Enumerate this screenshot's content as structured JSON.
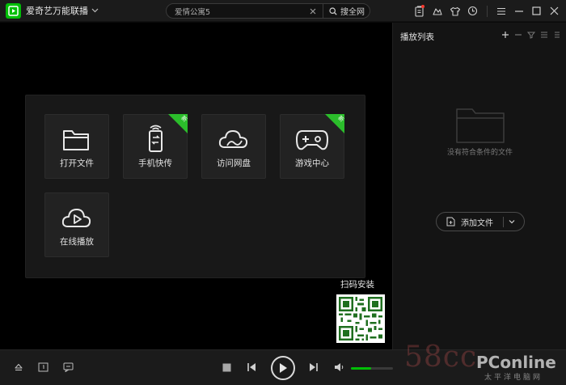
{
  "titlebar": {
    "app_title": "爱奇艺万能联播",
    "search_value": "爱情公寓5",
    "search_button_label": "搜全网"
  },
  "tiles": [
    {
      "label": "打开文件",
      "icon": "folder-icon",
      "badge": ""
    },
    {
      "label": "手机快传",
      "icon": "phone-transfer-icon",
      "badge": "新"
    },
    {
      "label": "访问网盘",
      "icon": "cloud-icon",
      "badge": ""
    },
    {
      "label": "游戏中心",
      "icon": "gamepad-icon",
      "badge": "新"
    },
    {
      "label": "在线播放",
      "icon": "cloud-play-icon",
      "badge": ""
    }
  ],
  "qr": {
    "label": "扫码安装"
  },
  "playlist": {
    "title": "播放列表",
    "empty_text": "没有符合条件的文件",
    "add_button_label": "添加文件"
  },
  "player": {
    "volume_fraction": 0.48
  },
  "watermark": {
    "left_text": "58cc",
    "brand": "PConline",
    "brand_sub": "太平洋电脑网"
  },
  "colors": {
    "accent": "#00be06",
    "background": "#000000",
    "panel": "#181818"
  }
}
